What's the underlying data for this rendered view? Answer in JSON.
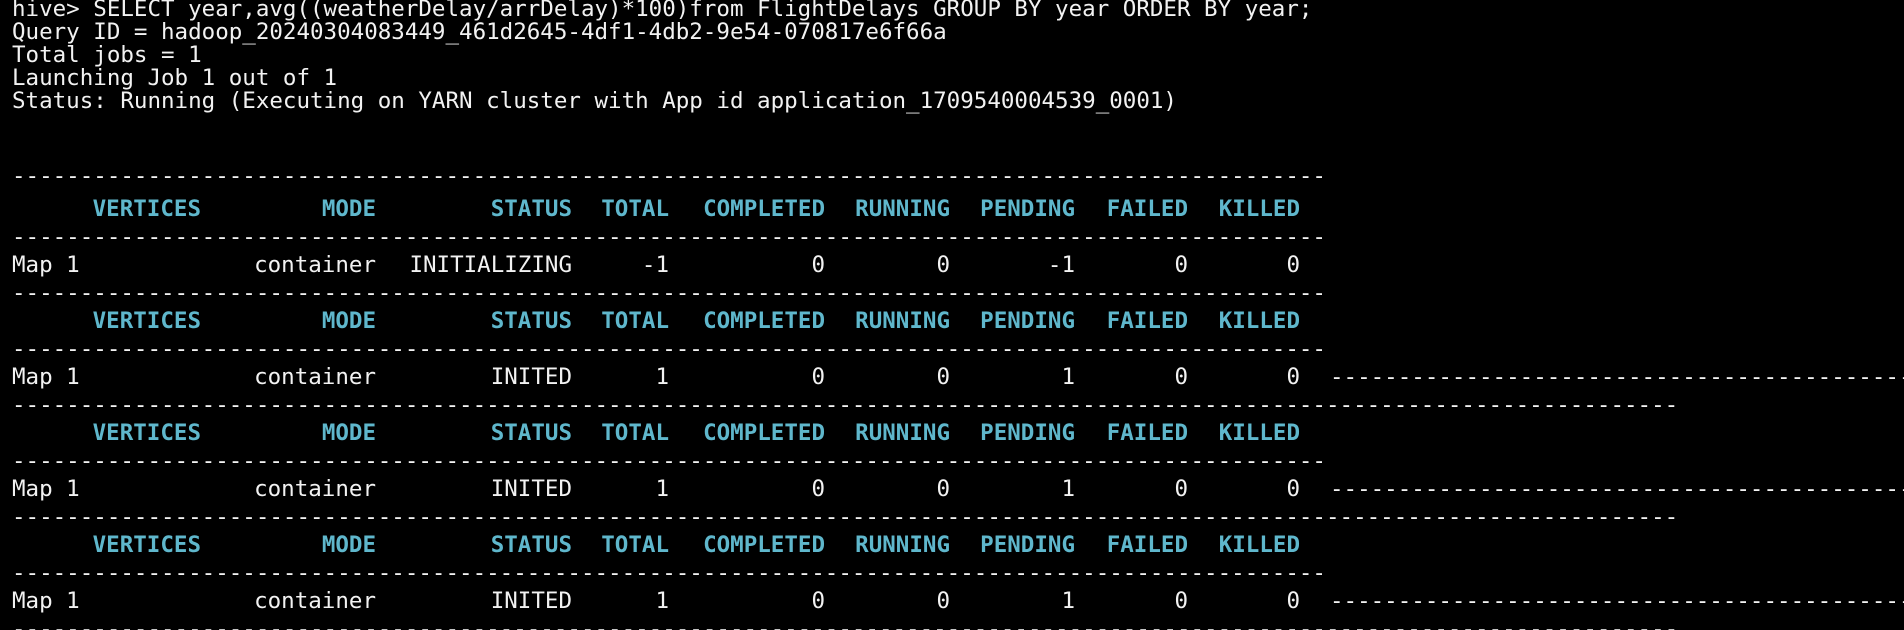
{
  "terminal": {
    "prompt_line": "hive> SELECT year,avg((weatherDelay/arrDelay)*100)from FlightDelays GROUP BY year ORDER BY year;",
    "query_id_line": "Query ID = hadoop_20240304083449_461d2645-4df1-4db2-9e54-070817e6f66a",
    "total_jobs_line": "Total jobs = 1",
    "launching_line": "Launching Job 1 out of 1",
    "status_line": "Status: Running (Executing on YARN cluster with App id application_1709540004539_0001)"
  },
  "headers": [
    "VERTICES",
    "MODE",
    "STATUS",
    "TOTAL",
    "COMPLETED",
    "RUNNING",
    "PENDING",
    "FAILED",
    "KILLED"
  ],
  "progress_tables": [
    {
      "vertex": "Map 1",
      "mode": "container",
      "status": "INITIALIZING",
      "total": "-1",
      "completed": "0",
      "running": "0",
      "pending": "-1",
      "failed": "0",
      "killed": "0"
    },
    {
      "vertex": "Map 1",
      "mode": "container",
      "status": "INITED",
      "total": "1",
      "completed": "0",
      "running": "0",
      "pending": "1",
      "failed": "0",
      "killed": "0"
    },
    {
      "vertex": "Map 1",
      "mode": "container",
      "status": "INITED",
      "total": "1",
      "completed": "0",
      "running": "0",
      "pending": "1",
      "failed": "0",
      "killed": "0"
    },
    {
      "vertex": "Map 1",
      "mode": "container",
      "status": "INITED",
      "total": "1",
      "completed": "0",
      "running": "0",
      "pending": "1",
      "failed": "0",
      "killed": "0"
    }
  ],
  "colors": {
    "background": "#000000",
    "text": "#f2f2f2",
    "header": "#5fb7cc"
  }
}
